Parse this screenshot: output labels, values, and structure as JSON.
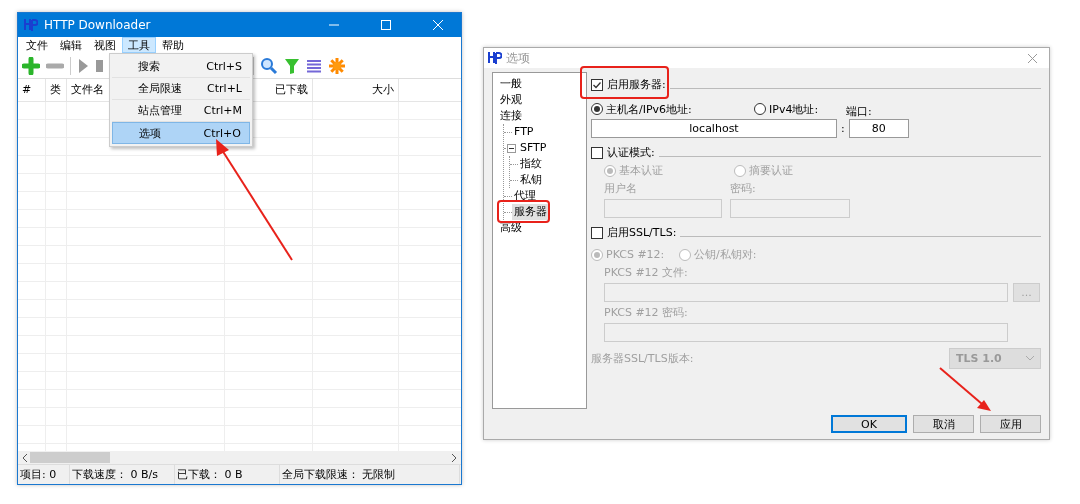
{
  "downloader": {
    "window": {
      "title": "HTTP Downloader"
    },
    "menu": [
      {
        "label": "文件",
        "selected": false
      },
      {
        "label": "编辑",
        "selected": false
      },
      {
        "label": "视图",
        "selected": false
      },
      {
        "label": "工具",
        "selected": true
      },
      {
        "label": "帮助",
        "selected": false
      }
    ],
    "dropdown": [
      {
        "label": "搜索",
        "shortcut": "Ctrl+S",
        "selected": false
      },
      {
        "label": "全局限速",
        "shortcut": "Ctrl+L",
        "selected": false
      },
      {
        "label": "站点管理",
        "shortcut": "Ctrl+M",
        "selected": false
      },
      {
        "label": "选项",
        "shortcut": "Ctrl+O",
        "selected": true
      }
    ],
    "table": {
      "columns": [
        "#",
        "类",
        "文件名",
        "已下载",
        "大小"
      ]
    },
    "status_bar": [
      "项目: 0",
      "下载速度： 0 B/s",
      "已下载： 0 B",
      "全局下载限速： 无限制"
    ]
  },
  "options": {
    "window": {
      "title": "选项"
    },
    "tree": [
      {
        "label": "一般",
        "selected": false
      },
      {
        "label": "外观",
        "selected": false
      },
      {
        "label": "连接",
        "selected": false,
        "children": [
          {
            "label": "FTP",
            "selected": false
          },
          {
            "label": "SFTP",
            "selected": false,
            "expanded": true,
            "children": [
              {
                "label": "指纹",
                "selected": false
              },
              {
                "label": "私钥",
                "selected": false
              }
            ]
          },
          {
            "label": "代理",
            "selected": false
          },
          {
            "label": "服务器",
            "selected": true
          }
        ]
      },
      {
        "label": "高级",
        "selected": false
      }
    ],
    "server": {
      "label": "启用服务器:",
      "checked": true
    },
    "host_modes": [
      {
        "label": "主机名/IPv6地址:",
        "selected": true
      },
      {
        "label": "IPv4地址:",
        "selected": false
      }
    ],
    "host": {
      "value": "localhost"
    },
    "separator": ":",
    "port": {
      "label": "端口:",
      "value": "80"
    },
    "auth": {
      "label": "认证模式:",
      "checked": false
    },
    "auth_modes": [
      {
        "label": "基本认证",
        "selected": true
      },
      {
        "label": "摘要认证",
        "selected": false
      }
    ],
    "username": {
      "label": "用户名"
    },
    "password": {
      "label": "密码:"
    },
    "ssl": {
      "label": "启用SSL/TLS:",
      "checked": false
    },
    "cert_modes": [
      {
        "label": "PKCS #12:",
        "selected": true
      },
      {
        "label": "公钥/私钥对:",
        "selected": false
      }
    ],
    "pkcs_file": {
      "label": "PKCS #12 文件:",
      "browse": "..."
    },
    "pkcs_password": {
      "label": "PKCS #12 密码:"
    },
    "tls_version": {
      "label": "服务器SSL/TLS版本:",
      "value": "TLS 1.0"
    },
    "buttons": [
      {
        "label": "OK",
        "default": true
      },
      {
        "label": "取消",
        "default": false
      },
      {
        "label": "应用",
        "default": false
      }
    ]
  }
}
